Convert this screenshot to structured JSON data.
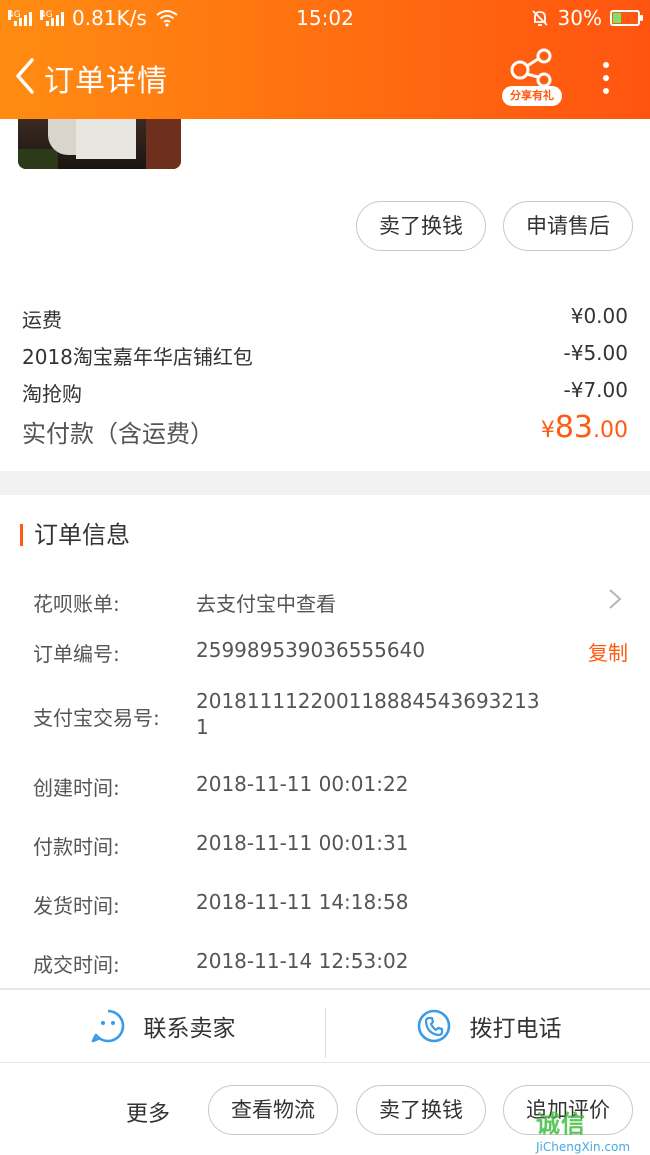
{
  "status_bar": {
    "network_tag": "4G",
    "network_tag_2": "4G",
    "speed": "0.81K/s",
    "time": "15:02",
    "battery": "30%",
    "battery_level": 0.3
  },
  "header": {
    "title": "订单详情",
    "share_badge": "分享有礼"
  },
  "product_actions": {
    "sell_button": "卖了换钱",
    "after_sale_button": "申请售后"
  },
  "fees": [
    {
      "label": "运费",
      "value": "¥0.00"
    },
    {
      "label": "2018淘宝嘉年华店铺红包",
      "value": "-¥5.00"
    },
    {
      "label": "淘抢购",
      "value": "-¥7.00"
    }
  ],
  "total": {
    "label": "实付款（含运费）",
    "currency": "¥",
    "integer": "83",
    "decimal": ".00"
  },
  "order_info": {
    "section_title": "订单信息",
    "rows": [
      {
        "label": "花呗账单:",
        "value": "去支付宝中查看"
      },
      {
        "label": "订单编号:",
        "value": "259989539036555640"
      },
      {
        "label": "支付宝交易号:",
        "value": "2018111122001188845436932131"
      },
      {
        "label": "创建时间:",
        "value": "2018-11-11 00:01:22"
      },
      {
        "label": "付款时间:",
        "value": "2018-11-11 00:01:31"
      },
      {
        "label": "发货时间:",
        "value": "2018-11-11 14:18:58"
      },
      {
        "label": "成交时间:",
        "value": "2018-11-14 12:53:02"
      }
    ],
    "copy_label": "复制"
  },
  "contact_bar": {
    "contact_seller": "联系卖家",
    "call_phone": "拨打电话"
  },
  "bottom_actions": {
    "more": "更多",
    "view_logistics": "查看物流",
    "sell_button": "卖了换钱",
    "add_review": "追加评价"
  },
  "watermark": {
    "text": "诚信",
    "url": "JiChengXin.com"
  },
  "colors": {
    "brand_orange": "#ff6a10",
    "accent": "#ff5a10",
    "icon_blue": "#3a9be8"
  }
}
